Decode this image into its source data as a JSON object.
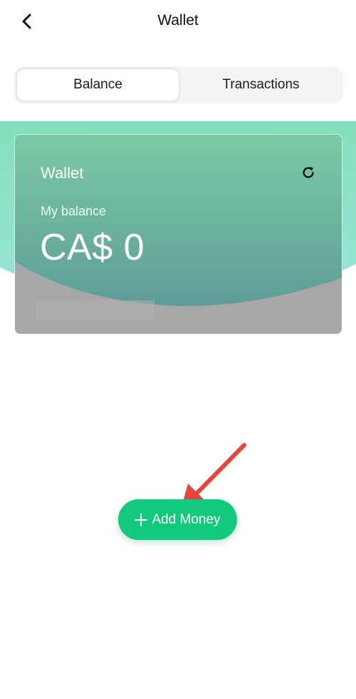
{
  "header": {
    "title": "Wallet",
    "back_icon": "chevron-left-icon"
  },
  "tabs": [
    {
      "label": "Balance",
      "active": true
    },
    {
      "label": "Transactions",
      "active": false
    }
  ],
  "wallet_card": {
    "title": "Wallet",
    "refresh_icon": "refresh-icon",
    "balance_label": "My balance",
    "balance_value": "CA$ 0"
  },
  "actions": {
    "add_money_label": "Add Money",
    "add_icon": "plus-icon"
  },
  "annotation": {
    "arrow_color": "#e8433f"
  },
  "colors": {
    "accent_green": "#12c97d",
    "card_top": "#7bcaa5",
    "card_bottom": "#5f9e99",
    "wave_light": "#8ee3c1"
  }
}
